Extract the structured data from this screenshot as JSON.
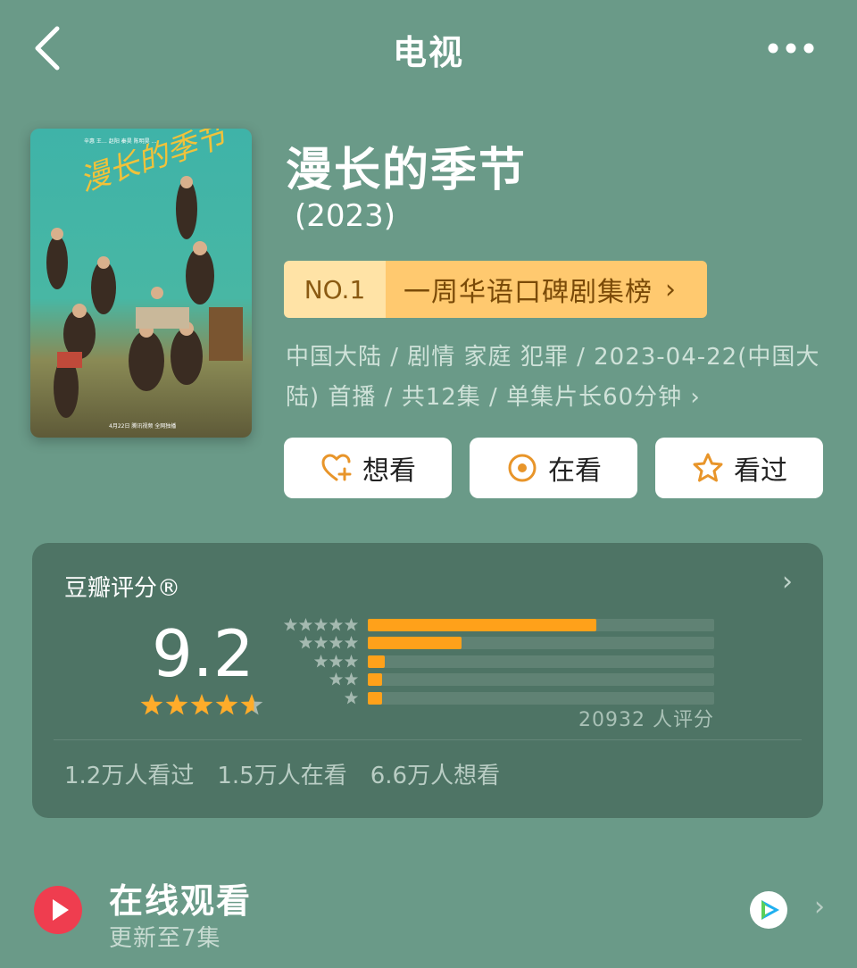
{
  "nav": {
    "title": "电视",
    "back_icon": "chevron-left-icon",
    "more_icon": "more-dots-icon"
  },
  "poster": {
    "title_art": "漫长的季节",
    "cast_line": "辛惠 王…   赵阳  秦昊  陈明昊  …",
    "release_line": "4月22日 腾讯视频 全网独播"
  },
  "subject": {
    "title": "漫长的季节",
    "year": "(2023)"
  },
  "rank": {
    "no": "NO.1",
    "name": "一周华语口碑剧集榜",
    "chevron": "›"
  },
  "meta": {
    "line1": "中国大陆 / 剧情 家庭 犯罪 / 2023-04-22(中国大",
    "line2": "陆) 首播 / 共12集 / 单集片长60分钟",
    "chevron": "›"
  },
  "actions": [
    {
      "label": "想看",
      "icon": "heart-plus-icon"
    },
    {
      "label": "在看",
      "icon": "target-circle-icon"
    },
    {
      "label": "看过",
      "icon": "star-outline-icon"
    }
  ],
  "rating": {
    "label": "豆瓣评分®",
    "chevron": "›",
    "score": "9.2",
    "stars_value": 4.6,
    "distribution": [
      {
        "stars": 5,
        "percent": 66
      },
      {
        "stars": 4,
        "percent": 27
      },
      {
        "stars": 3,
        "percent": 5
      },
      {
        "stars": 2,
        "percent": 4
      },
      {
        "stars": 1,
        "percent": 4
      }
    ],
    "votes": "20932 人评分",
    "stats": [
      "1.2万人看过",
      "1.5万人在看",
      "6.6万人想看"
    ]
  },
  "online": {
    "title": "在线观看",
    "subtitle": "更新至7集",
    "chevron": "›",
    "play_icon": "play-icon",
    "platform_icon": "tencent-video-icon"
  },
  "colors": {
    "background": "#6a9a88",
    "accent": "#ffa11a",
    "play": "#ef3d4f"
  }
}
